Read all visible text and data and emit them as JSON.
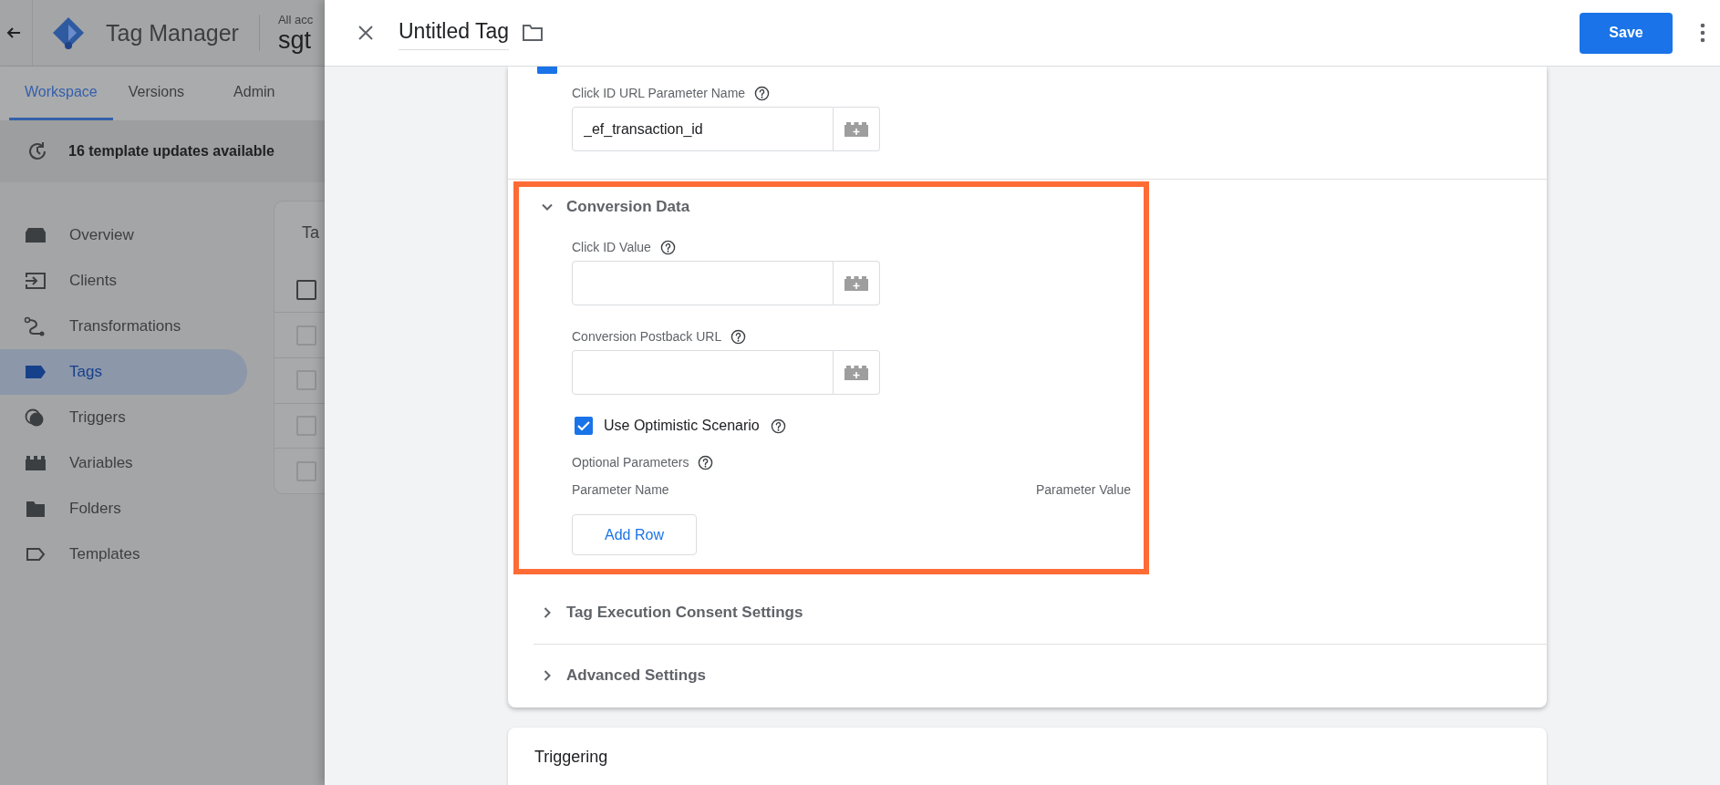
{
  "background_app": {
    "product_name": "Tag Manager",
    "account_label": "All acc",
    "container_name": "sgt",
    "tabs": [
      {
        "label": "Workspace",
        "selected": true
      },
      {
        "label": "Versions",
        "selected": false
      },
      {
        "label": "Admin",
        "selected": false
      }
    ],
    "notice": "16 template updates available",
    "sidebar": {
      "items": [
        {
          "label": "Overview",
          "selected": false
        },
        {
          "label": "Clients",
          "selected": false
        },
        {
          "label": "Transformations",
          "selected": false
        },
        {
          "label": "Tags",
          "selected": true
        },
        {
          "label": "Triggers",
          "selected": false
        },
        {
          "label": "Variables",
          "selected": false
        },
        {
          "label": "Folders",
          "selected": false
        },
        {
          "label": "Templates",
          "selected": false
        }
      ]
    },
    "table_card": {
      "title": "Ta",
      "header_checkbox": {
        "checked": false
      },
      "rows": [
        {
          "checked": false
        },
        {
          "checked": false
        },
        {
          "checked": false
        },
        {
          "checked": false
        }
      ]
    }
  },
  "panel": {
    "title": "Untitled Tag",
    "save_button": "Save"
  },
  "tag_config": {
    "override_checkbox": {
      "checked": true
    },
    "click_id_param": {
      "label": "Click ID URL Parameter Name",
      "value": "_ef_transaction_id"
    },
    "sections": [
      {
        "title": "Conversion Data",
        "expanded": true,
        "highlighted": true,
        "fields": [
          {
            "kind": "variable_input",
            "label": "Click ID Value"
          },
          {
            "kind": "variable_input",
            "label": "Conversion Postback URL"
          },
          {
            "kind": "checkbox",
            "label": "Use Optimistic Scenario",
            "checked": true
          },
          {
            "kind": "param_table",
            "label": "Optional Parameters",
            "columns": [
              "Parameter Name",
              "Parameter Value"
            ],
            "add_button": "Add Row"
          }
        ]
      },
      {
        "title": "Tag Execution Consent Settings",
        "expanded": false,
        "highlighted": false
      },
      {
        "title": "Advanced Settings",
        "expanded": false,
        "highlighted": false
      }
    ]
  },
  "triggering": {
    "title": "Triggering"
  }
}
